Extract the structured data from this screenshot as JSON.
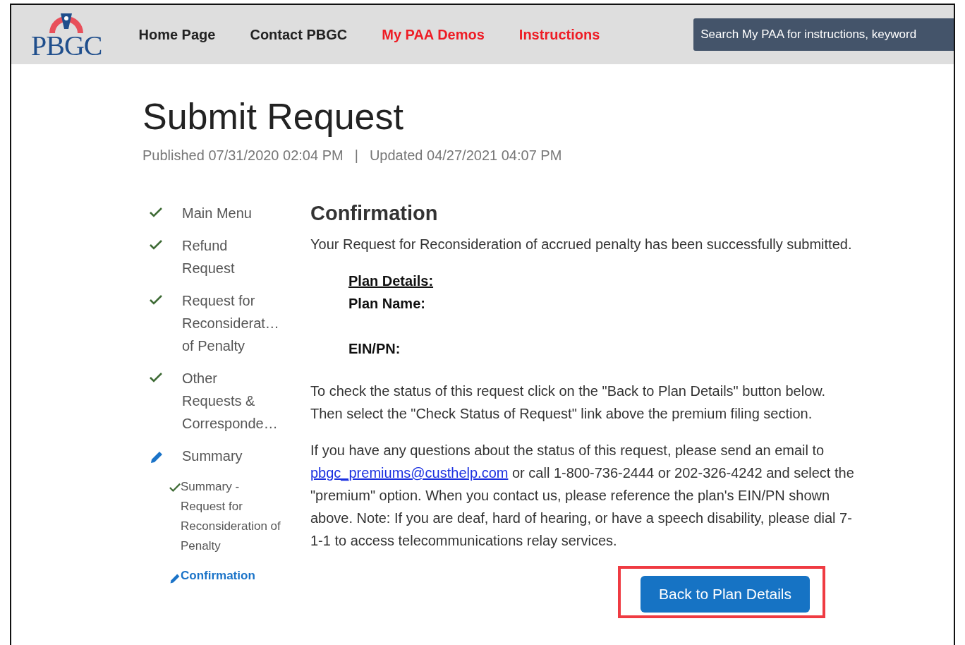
{
  "header": {
    "logo": "PBGC",
    "nav": [
      {
        "label": "Home Page",
        "accent": false
      },
      {
        "label": "Contact PBGC",
        "accent": false
      },
      {
        "label": "My PAA Demos",
        "accent": true
      },
      {
        "label": "Instructions",
        "accent": true
      }
    ],
    "search": {
      "placeholder": "Search My PAA for instructions, keyword"
    }
  },
  "page": {
    "title": "Submit Request",
    "published": "Published 07/31/2020 02:04 PM",
    "separator": "|",
    "updated": "Updated 04/27/2021 04:07 PM"
  },
  "steps": [
    {
      "label": "Main Menu",
      "kind": "done",
      "selected": false
    },
    {
      "label": "Refund Request",
      "kind": "done",
      "selected": false
    },
    {
      "label": "Request for Reconsiderat… of Penalty",
      "kind": "done",
      "selected": false
    },
    {
      "label": "Other Requests & Corresponde…",
      "kind": "done",
      "selected": false
    },
    {
      "label": "Summary",
      "kind": "editing",
      "selected": false,
      "children": [
        {
          "label": "Summary - Request for Reconsideration of Penalty",
          "kind": "done",
          "selected": false
        },
        {
          "label": "Confirmation",
          "kind": "editing",
          "selected": true
        }
      ]
    }
  ],
  "confirmation": {
    "heading": "Confirmation",
    "message": "Your Request for Reconsideration of accrued penalty has been successfully submitted.",
    "details_heading": "Plan Details:",
    "plan_name_label": "Plan Name:",
    "ein_label": "EIN/PN:",
    "status_text": "To check the status of this request click on the \"Back to Plan Details\" button below. Then select the \"Check Status of Request\" link above the premium filing section.",
    "contact_before": "If you have any questions about the status of this request, please send an email to",
    "email": "pbgc_premiums@custhelp.com",
    "contact_after": "or call 1-800-736-2444 or 202-326-4242 and select the \"premium\" option. When you contact us, please reference the plan's EIN/PN shown above. Note: If you are deaf, hard of hearing, or have a speech disability, please dial 7-1-1 to access telecommunications relay services.",
    "button": {
      "label": "Back to Plan Details",
      "highlighted": true
    }
  }
}
